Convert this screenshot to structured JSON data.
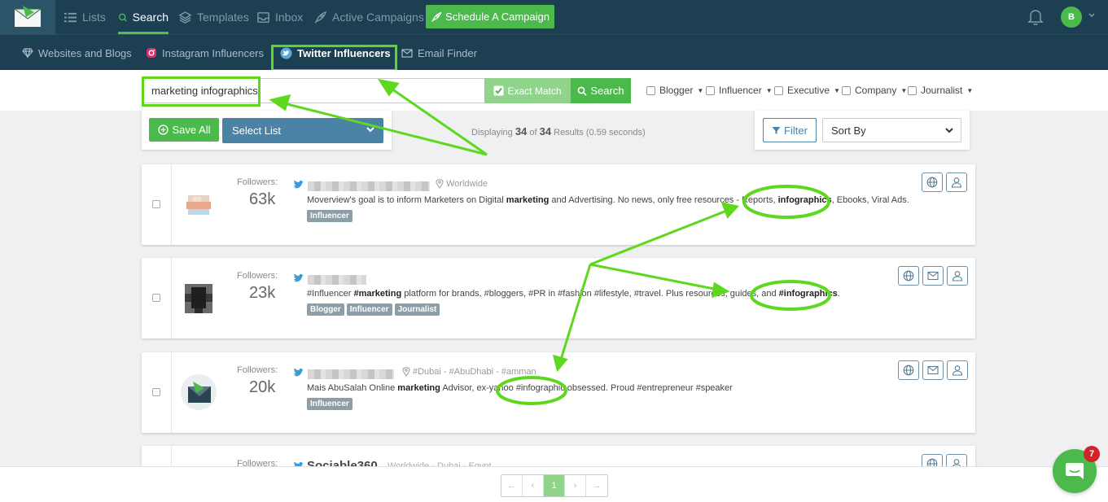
{
  "nav": {
    "items": [
      {
        "label": "Lists",
        "icon": "list-icon"
      },
      {
        "label": "Search",
        "icon": "search-icon"
      },
      {
        "label": "Templates",
        "icon": "layers-icon"
      },
      {
        "label": "Inbox",
        "icon": "inbox-icon"
      },
      {
        "label": "Active Campaigns",
        "icon": "rocket-icon"
      }
    ],
    "schedule_label": "Schedule A Campaign",
    "avatar_initial": "B"
  },
  "subnav": {
    "items": [
      {
        "label": "Websites and Blogs",
        "icon": "diamond-icon"
      },
      {
        "label": "Instagram Influencers",
        "icon": "instagram-icon"
      },
      {
        "label": "Twitter Influencers",
        "icon": "twitter-icon"
      },
      {
        "label": "Email Finder",
        "icon": "envelope-icon"
      }
    ]
  },
  "search": {
    "value": "marketing infographics",
    "exact_match_label": "Exact Match",
    "search_label": "Search",
    "filters": [
      "Blogger",
      "Influencer",
      "Executive",
      "Company",
      "Journalist"
    ]
  },
  "controls": {
    "save_all_label": "Save All",
    "select_list_label": "Select List",
    "displaying_prefix": "Displaying",
    "shown": "34",
    "of_label": "of",
    "total": "34",
    "results_suffix": "Results (0.59 seconds)",
    "filter_label": "Filter",
    "sort_label": "Sort By"
  },
  "followers_label": "Followers:",
  "results": [
    {
      "followers": "63k",
      "location": "Worldwide",
      "bio_parts": [
        "Moverview's goal is to inform Marketers on Digital ",
        "marketing",
        " and Advertising. No news, only free resources - Reports, ",
        "infographics",
        ", Ebooks, Viral Ads."
      ],
      "tags": [
        "Influencer"
      ]
    },
    {
      "followers": "23k",
      "location": "",
      "bio_parts": [
        "#Influencer ",
        "#marketing",
        " platform for brands, #bloggers, #PR in #fashion #lifestyle, #travel. Plus resources, guides, and ",
        "#infographics",
        "."
      ],
      "tags": [
        "Blogger",
        "Influencer",
        "Journalist"
      ]
    },
    {
      "followers": "20k",
      "location": "#Dubai - #AbuDhabi - #amman",
      "bio_parts": [
        "Mais AbuSalah Online ",
        "marketing",
        " Advisor, ex-yahoo #infographic obsessed. Proud #entrepreneur #speaker",
        "",
        ""
      ],
      "tags": [
        "Influencer"
      ]
    },
    {
      "followers": "",
      "name": "Sociable360",
      "location": "Worldwide - Dubai - Egypt",
      "bio_parts": [
        "",
        "",
        "",
        "",
        ""
      ],
      "tags": []
    }
  ],
  "pagination": {
    "first": "←",
    "prev": "‹",
    "current": "1",
    "next": "›",
    "last": "→"
  },
  "chat": {
    "badge": "7"
  },
  "colors": {
    "nav_bg": "#1d3f52",
    "accent_green": "#4cb94c",
    "highlight": "#5ed81e",
    "select_blue": "#4a83a6"
  }
}
